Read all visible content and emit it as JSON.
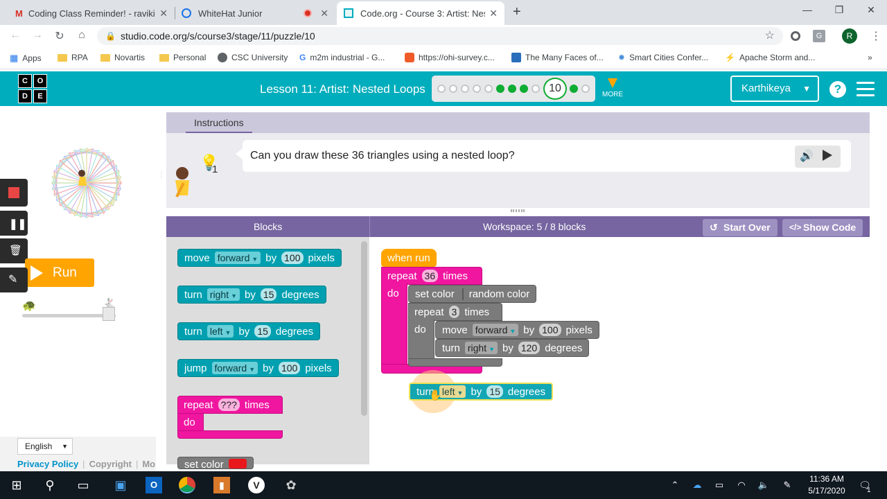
{
  "browser": {
    "tabs": [
      {
        "title": "Coding Class Reminder! - ravikira",
        "icon": "gmail-icon"
      },
      {
        "title": "WhiteHat Junior",
        "icon": "whitehat-icon"
      },
      {
        "title": "Code.org - Course 3: Artist: Neste",
        "icon": "codeorg-icon"
      }
    ],
    "url": "studio.code.org/s/course3/stage/11/puzzle/10",
    "profile_initial": "R",
    "bookmarks": [
      "Apps",
      "RPA",
      "Novartis",
      "Personal",
      "CSC University",
      "m2m industrial - G...",
      "https://ohi-survey.c...",
      "The Many Faces of...",
      "Smart Cities Confer...",
      "Apache Storm and..."
    ]
  },
  "header": {
    "logo_letters": [
      "C",
      "O",
      "D",
      "E"
    ],
    "lesson_title": "Lesson 11: Artist: Nested Loops",
    "progress": {
      "total_before_current": 9,
      "completed": [
        6,
        7,
        8
      ],
      "current": "10",
      "after_completed": [
        11
      ]
    },
    "more_label": "MORE",
    "user_name": "Karthikeya",
    "help_label": "?"
  },
  "left": {
    "run_label": "Run",
    "language": "English",
    "footer_links": [
      "Privacy Policy",
      "Copyright",
      "Mo"
    ]
  },
  "instructions": {
    "tab_label": "Instructions",
    "hint_count": "1",
    "text": "Can you draw these 36 triangles using a nested loop?"
  },
  "workspace": {
    "blocks_header": "Blocks",
    "workspace_header": "Workspace: 5 / 8 blocks",
    "start_over": "Start Over",
    "show_code": "Show Code"
  },
  "toolbox": [
    {
      "kind": "move",
      "w1": "move",
      "dd": "forward",
      "w2": "by",
      "n": "100",
      "w3": "pixels"
    },
    {
      "kind": "turn",
      "w1": "turn",
      "dd": "right",
      "w2": "by",
      "n": "15",
      "w3": "degrees"
    },
    {
      "kind": "turn",
      "w1": "turn",
      "dd": "left",
      "w2": "by",
      "n": "15",
      "w3": "degrees"
    },
    {
      "kind": "jump",
      "w1": "jump",
      "dd": "forward",
      "w2": "by",
      "n": "100",
      "w3": "pixels"
    },
    {
      "kind": "repeat",
      "w1": "repeat",
      "n": "???",
      "w3": "times",
      "do": "do"
    },
    {
      "kind": "setcolor",
      "w1": "set color"
    }
  ],
  "program": {
    "when_run": "when run",
    "repeat_outer": {
      "w1": "repeat",
      "n": "36",
      "w3": "times",
      "do": "do"
    },
    "set_color": {
      "w1": "set color",
      "value": "random color"
    },
    "repeat_inner": {
      "w1": "repeat",
      "n": "3",
      "w3": "times",
      "do": "do"
    },
    "move": {
      "w1": "move",
      "dd": "forward",
      "w2": "by",
      "n": "100",
      "w3": "pixels"
    },
    "turn": {
      "w1": "turn",
      "dd": "right",
      "w2": "by",
      "n": "120",
      "w3": "degrees"
    },
    "dragging": {
      "w1": "turn",
      "dd": "left",
      "w2": "by",
      "n": "15",
      "w3": "degrees"
    }
  },
  "taskbar": {
    "time": "11:36 AM",
    "date": "5/17/2020",
    "notification_count": "1"
  }
}
